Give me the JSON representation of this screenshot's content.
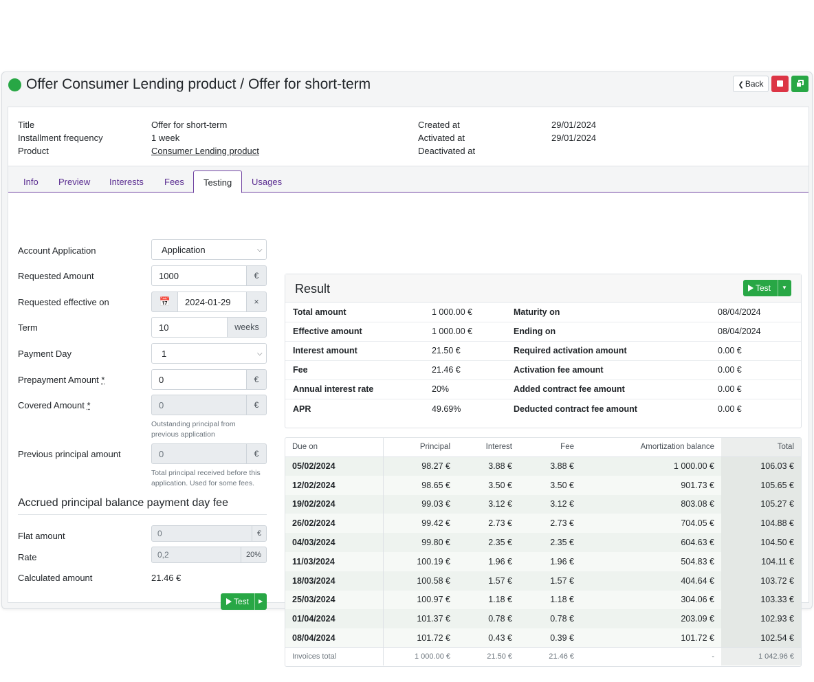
{
  "header": {
    "title": "Offer Consumer Lending product / Offer for short-term",
    "back_label": "Back"
  },
  "summary": {
    "title_label": "Title",
    "title_value": "Offer for short-term",
    "freq_label": "Installment frequency",
    "freq_value": "1 week",
    "product_label": "Product",
    "product_value": "Consumer Lending product",
    "created_label": "Created at",
    "created_value": "29/01/2024",
    "activated_label": "Activated at",
    "activated_value": "29/01/2024",
    "deactivated_label": "Deactivated at"
  },
  "tabs": [
    "Info",
    "Preview",
    "Interests",
    "Fees",
    "Testing",
    "Usages"
  ],
  "form": {
    "account_application": {
      "label": "Account Application",
      "value": "Application"
    },
    "requested_amount": {
      "label": "Requested Amount",
      "value": "1000",
      "unit": "€"
    },
    "requested_effective_on": {
      "label": "Requested effective on",
      "value": "2024-01-29",
      "clear": "×"
    },
    "term": {
      "label": "Term",
      "value": "10",
      "unit": "weeks"
    },
    "payment_day": {
      "label": "Payment Day",
      "value": "1"
    },
    "prepayment_amount": {
      "label": "Prepayment Amount",
      "req": "*",
      "value": "0",
      "unit": "€"
    },
    "covered_amount": {
      "label": "Covered Amount",
      "req": "*",
      "value": "0",
      "unit": "€",
      "hint": "Outstanding principal from previous application"
    },
    "previous_principal": {
      "label": "Previous principal amount",
      "value": "0",
      "unit": "€",
      "hint": "Total principal received before this application. Used for some fees."
    }
  },
  "fee_section": {
    "title": "Accrued principal balance payment day fee",
    "flat_label": "Flat amount",
    "flat_value": "0",
    "flat_unit": "€",
    "rate_label": "Rate",
    "rate_value": "0,2",
    "rate_unit": "20%",
    "calc_label": "Calculated amount",
    "calc_value": "21.46 €",
    "test_label": "Test"
  },
  "result": {
    "title": "Result",
    "test_label": "Test",
    "left": [
      {
        "k": "Total amount",
        "v": "1 000.00 €"
      },
      {
        "k": "Effective amount",
        "v": "1 000.00 €"
      },
      {
        "k": "Interest amount",
        "v": "21.50 €"
      },
      {
        "k": "Fee",
        "v": "21.46 €"
      },
      {
        "k": "Annual interest rate",
        "v": "20%"
      },
      {
        "k": "APR",
        "v": "49.69%"
      }
    ],
    "right": [
      {
        "k": "Maturity on",
        "v": "08/04/2024"
      },
      {
        "k": "Ending on",
        "v": "08/04/2024"
      },
      {
        "k": "Required activation amount",
        "v": "0.00 €"
      },
      {
        "k": "Activation fee amount",
        "v": "0.00 €"
      },
      {
        "k": "Added contract fee amount",
        "v": "0.00 €"
      },
      {
        "k": "Deducted contract fee amount",
        "v": "0.00 €"
      }
    ]
  },
  "schedule": {
    "headers": [
      "Due on",
      "Principal",
      "Interest",
      "Fee",
      "Amortization balance",
      "Total"
    ],
    "rows": [
      [
        "05/02/2024",
        "98.27 €",
        "3.88 €",
        "3.88 €",
        "1 000.00 €",
        "106.03 €"
      ],
      [
        "12/02/2024",
        "98.65 €",
        "3.50 €",
        "3.50 €",
        "901.73 €",
        "105.65 €"
      ],
      [
        "19/02/2024",
        "99.03 €",
        "3.12 €",
        "3.12 €",
        "803.08 €",
        "105.27 €"
      ],
      [
        "26/02/2024",
        "99.42 €",
        "2.73 €",
        "2.73 €",
        "704.05 €",
        "104.88 €"
      ],
      [
        "04/03/2024",
        "99.80 €",
        "2.35 €",
        "2.35 €",
        "604.63 €",
        "104.50 €"
      ],
      [
        "11/03/2024",
        "100.19 €",
        "1.96 €",
        "1.96 €",
        "504.83 €",
        "104.11 €"
      ],
      [
        "18/03/2024",
        "100.58 €",
        "1.57 €",
        "1.57 €",
        "404.64 €",
        "103.72 €"
      ],
      [
        "25/03/2024",
        "100.97 €",
        "1.18 €",
        "1.18 €",
        "304.06 €",
        "103.33 €"
      ],
      [
        "01/04/2024",
        "101.37 €",
        "0.78 €",
        "0.78 €",
        "203.09 €",
        "102.93 €"
      ],
      [
        "08/04/2024",
        "101.72 €",
        "0.43 €",
        "0.39 €",
        "101.72 €",
        "102.54 €"
      ]
    ],
    "footer": [
      "Invoices total",
      "1 000.00 €",
      "21.50 €",
      "21.46 €",
      "-",
      "1 042.96 €"
    ]
  },
  "colors": {
    "success": "#28a745",
    "danger": "#dc3545",
    "tab_accent": "#6f42a1"
  }
}
